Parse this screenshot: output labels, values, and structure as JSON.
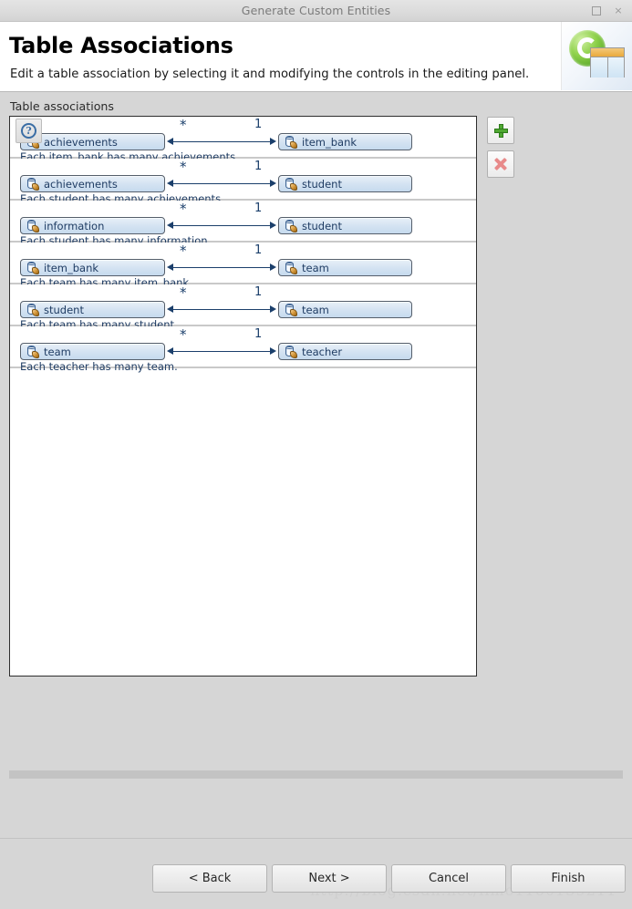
{
  "window": {
    "title": "Generate Custom Entities",
    "controls": {
      "maximize": "maximize-icon",
      "close": "×"
    }
  },
  "header": {
    "title": "Table Associations",
    "description": "Edit a table association by selecting it and modifying the controls in the editing panel.",
    "image": "green-c-table-icon"
  },
  "main": {
    "group_label": "Table associations",
    "associations": [
      {
        "left_entity": "achievements",
        "right_entity": "item_bank",
        "left_multiplicity": "*",
        "right_multiplicity": "1",
        "description": "Each item_bank has many achievements."
      },
      {
        "left_entity": "achievements",
        "right_entity": "student",
        "left_multiplicity": "*",
        "right_multiplicity": "1",
        "description": "Each student has many achievements."
      },
      {
        "left_entity": "information",
        "right_entity": "student",
        "left_multiplicity": "*",
        "right_multiplicity": "1",
        "description": "Each student has many information."
      },
      {
        "left_entity": "item_bank",
        "right_entity": "team",
        "left_multiplicity": "*",
        "right_multiplicity": "1",
        "description": "Each team has many item_bank."
      },
      {
        "left_entity": "student",
        "right_entity": "team",
        "left_multiplicity": "*",
        "right_multiplicity": "1",
        "description": "Each team has many student."
      },
      {
        "left_entity": "team",
        "right_entity": "teacher",
        "left_multiplicity": "*",
        "right_multiplicity": "1",
        "description": "Each teacher has many team."
      }
    ],
    "side_buttons": {
      "add": "add-association-icon",
      "remove": "remove-association-icon"
    }
  },
  "footer": {
    "help": "?",
    "buttons": [
      {
        "label": "< Back",
        "name": "back-button"
      },
      {
        "label": "Next >",
        "name": "next-button"
      },
      {
        "label": "Cancel",
        "name": "cancel-button"
      },
      {
        "label": "Finish",
        "name": "finish-button"
      }
    ]
  },
  "watermark": "http://blog.csdn.net/limo1160139211",
  "colors": {
    "entity_fill": "#d4e3f2",
    "entity_text": "#1f3c63",
    "arrow": "#1b3f6b",
    "add_green": "#4fa832",
    "remove_red": "#e88a8a",
    "window_bg": "#d6d6d6"
  }
}
